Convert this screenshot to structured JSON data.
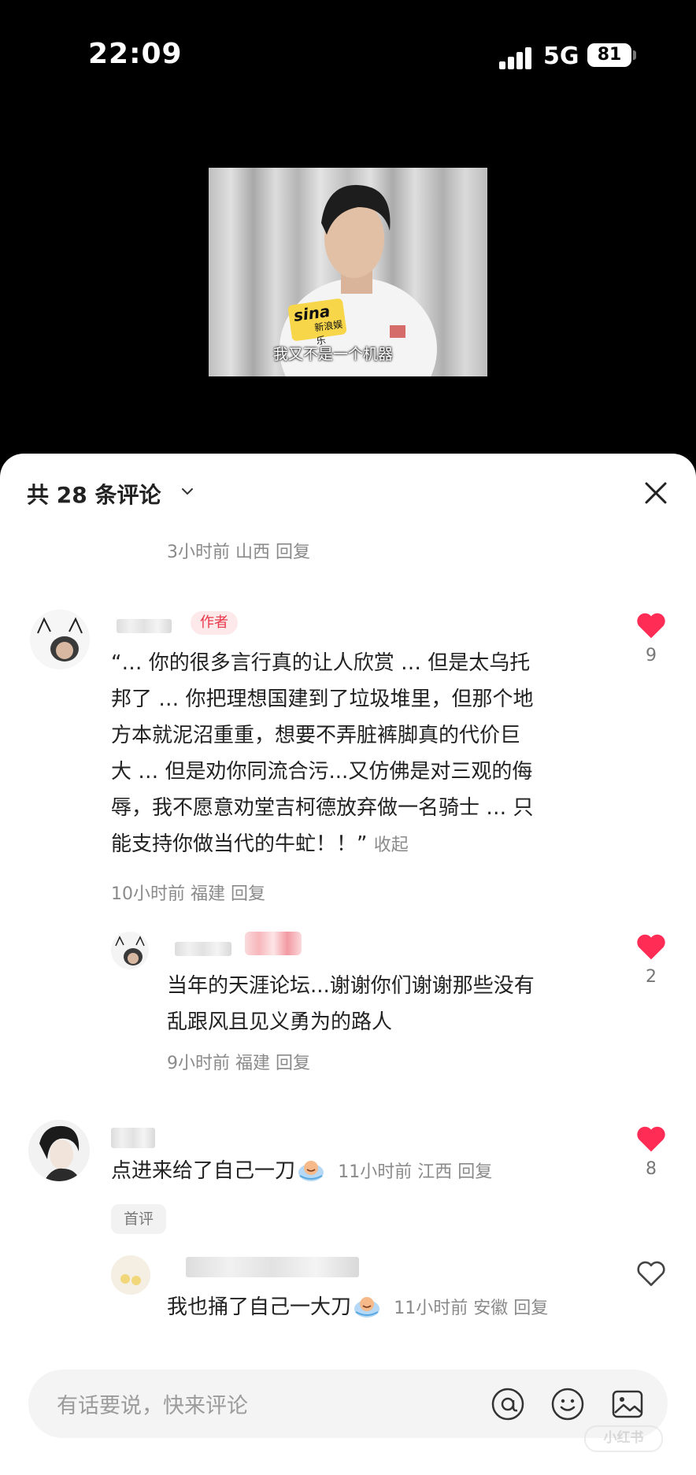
{
  "status_bar": {
    "time": "22:09",
    "network": "5G",
    "battery": "81"
  },
  "video": {
    "caption": "我又不是一个机器",
    "logo_word": "sina",
    "logo_sub": "新浪娱乐"
  },
  "comments_header": {
    "title": "共 28 条评论"
  },
  "top_meta": {
    "time": "3小时前",
    "location": "山西",
    "reply": "回复"
  },
  "comments": [
    {
      "author_tag": "作者",
      "text_lines": [
        "“… 你的很多言行真的让人欣赏 … 但是太乌托",
        "邦了 … 你把理想国建到了垃圾堆里，但那个地",
        "方本就泥沼重重，想要不弄脏裤脚真的代价巨",
        "大 … 但是劝你同流合污...又仿佛是对三观的侮",
        "辱，我不愿意劝堂吉柯德放弃做一名骑士 … 只",
        "能支持你做当代的牛虻！！”"
      ],
      "collapse_label": "收起",
      "time": "10小时前",
      "location": "福建",
      "reply": "回复",
      "likes": "9",
      "liked": true,
      "replies": [
        {
          "text_lines": [
            "当年的天涯论坛...谢谢你们谢谢那些没有",
            "乱跟风且见义勇为的路人"
          ],
          "time": "9小时前",
          "location": "福建",
          "reply": "回复",
          "likes": "2",
          "liked": true
        }
      ]
    },
    {
      "text": "点进来给了自己一刀",
      "emoji": "crying-emoji",
      "time": "11小时前",
      "location": "江西",
      "reply": "回复",
      "likes": "8",
      "liked": true,
      "badge": "首评",
      "replies": [
        {
          "text": "我也捅了自己一大刀",
          "emoji": "crying-emoji",
          "time": "11小时前",
          "location": "安徽",
          "reply": "回复",
          "liked": false
        }
      ]
    }
  ],
  "input_bar": {
    "placeholder": "有话要说，快来评论"
  },
  "watermark": "小红书",
  "colors": {
    "like_red": "#ff2c55",
    "sheet_bg": "#ffffff",
    "meta_gray": "#8a8a8a"
  }
}
